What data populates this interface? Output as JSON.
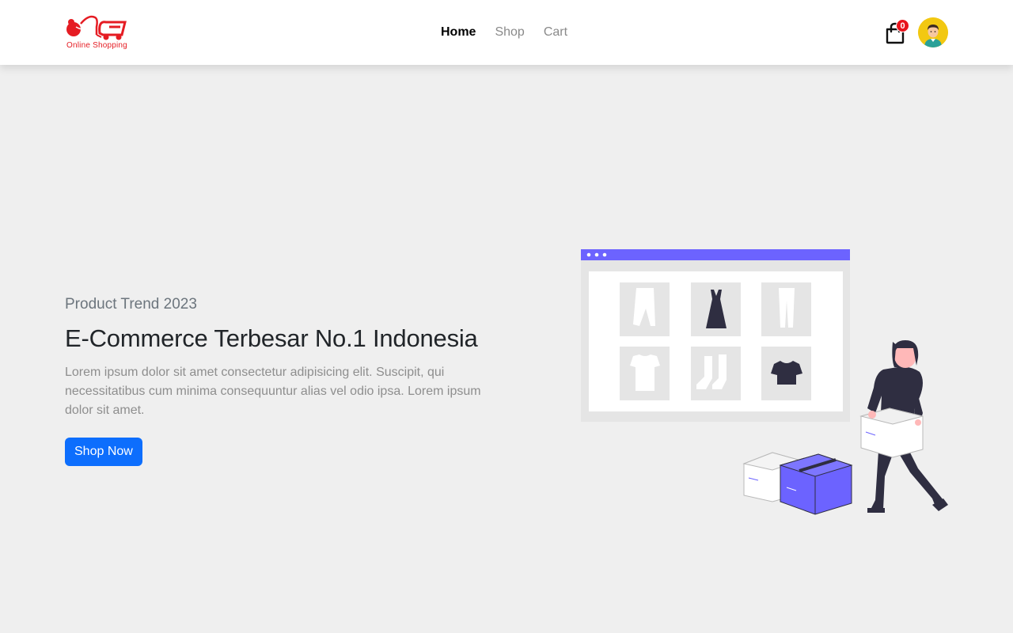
{
  "brand": {
    "logo_text": "Online Shopping",
    "brand_color": "#e51c23"
  },
  "nav": {
    "links": [
      {
        "label": "Home",
        "active": true
      },
      {
        "label": "Shop",
        "active": false
      },
      {
        "label": "Cart",
        "active": false
      }
    ]
  },
  "header_actions": {
    "cart_icon": "shopping-bag-icon",
    "cart_count": "0",
    "avatar_icon": "user-avatar-icon"
  },
  "hero": {
    "subtitle": "Product Trend 2023",
    "title": "E-Commerce Terbesar No.1 Indonesia",
    "description": "Lorem ipsum dolor sit amet consectetur adipisicing elit. Suscipit, qui necessitatibus cum minima consequuntur alias vel odio ipsa. Lorem ipsum dolor sit amet.",
    "cta_label": "Shop Now",
    "accent_color": "#0d6efd",
    "illustration_accent": "#6c63ff"
  }
}
